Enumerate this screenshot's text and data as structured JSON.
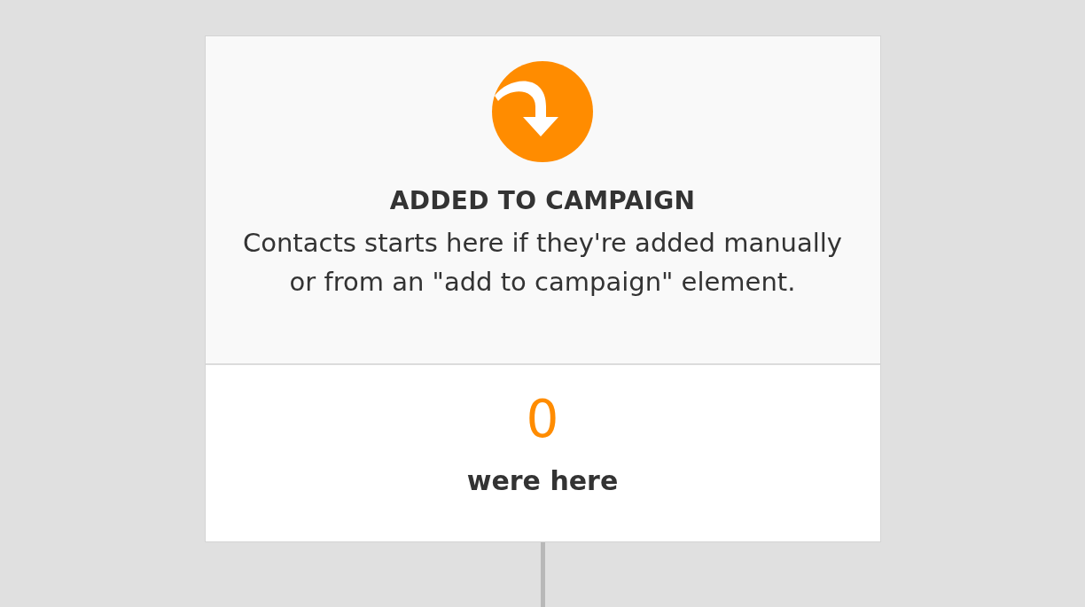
{
  "card": {
    "title": "ADDED TO CAMPAIGN",
    "description": "Contacts starts here if they're added manually or from an \"add to campaign\" element.",
    "count": "0",
    "count_label": "were here"
  }
}
